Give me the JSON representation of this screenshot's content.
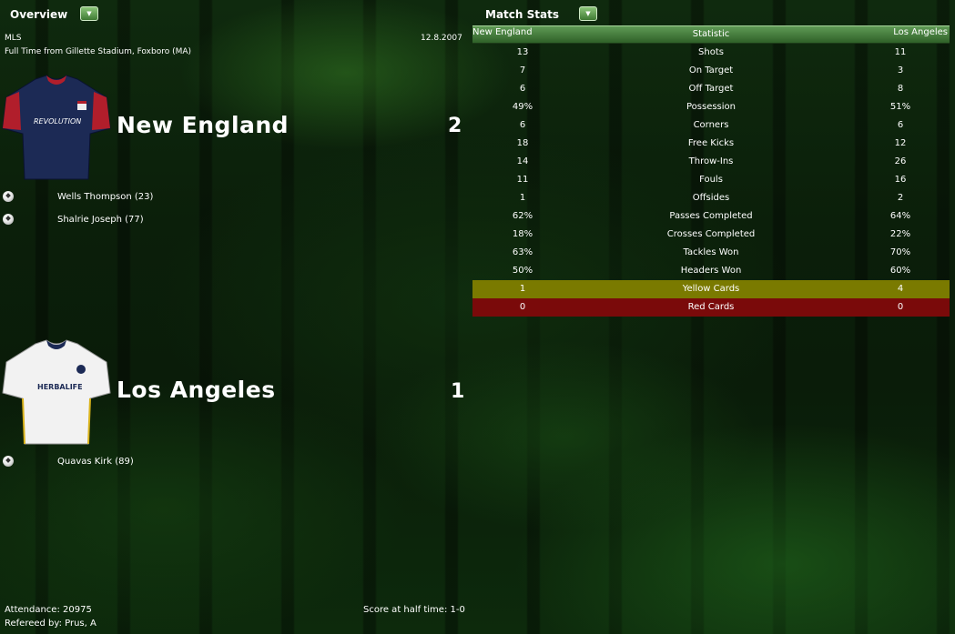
{
  "overview": {
    "title": "Overview",
    "competition": "MLS",
    "date": "12.8.2007",
    "venue": "Full Time from Gillette Stadium, Foxboro (MA)"
  },
  "match_stats_panel": {
    "title": "Match Stats"
  },
  "home": {
    "name": "New England",
    "score": "2",
    "shirt_text": "REVOLUTION",
    "scorers": [
      "Wells Thompson (23)",
      "Shalrie Joseph (77)"
    ]
  },
  "away": {
    "name": "Los Angeles",
    "score": "1",
    "shirt_text": "HERBALIFE",
    "scorers": [
      "Quavas Kirk (89)"
    ]
  },
  "stats_table": {
    "headers": {
      "home": "New England",
      "stat": "Statistic",
      "away": "Los Angeles"
    },
    "rows": [
      {
        "home": "13",
        "stat": "Shots",
        "away": "11"
      },
      {
        "home": "7",
        "stat": "On Target",
        "away": "3"
      },
      {
        "home": "6",
        "stat": "Off Target",
        "away": "8"
      },
      {
        "home": "49%",
        "stat": "Possession",
        "away": "51%"
      },
      {
        "home": "6",
        "stat": "Corners",
        "away": "6"
      },
      {
        "home": "18",
        "stat": "Free Kicks",
        "away": "12"
      },
      {
        "home": "14",
        "stat": "Throw-Ins",
        "away": "26"
      },
      {
        "home": "11",
        "stat": "Fouls",
        "away": "16"
      },
      {
        "home": "1",
        "stat": "Offsides",
        "away": "2"
      },
      {
        "home": "62%",
        "stat": "Passes Completed",
        "away": "64%"
      },
      {
        "home": "18%",
        "stat": "Crosses Completed",
        "away": "22%"
      },
      {
        "home": "63%",
        "stat": "Tackles Won",
        "away": "70%"
      },
      {
        "home": "50%",
        "stat": "Headers Won",
        "away": "60%"
      },
      {
        "home": "1",
        "stat": "Yellow Cards",
        "away": "4",
        "highlight": "yellow"
      },
      {
        "home": "0",
        "stat": "Red Cards",
        "away": "0",
        "highlight": "red"
      }
    ]
  },
  "footer": {
    "attendance": "Attendance: 20975",
    "referee": "Refereed by: Prus, A",
    "half_time": "Score at half time: 1-0"
  },
  "colors": {
    "header_green": "#3f7a33",
    "yellow_card_row": "#7a7a00",
    "red_card_row": "#7a0a0a",
    "home_shirt": "#1c2a55",
    "away_shirt": "#f2f2f2"
  }
}
